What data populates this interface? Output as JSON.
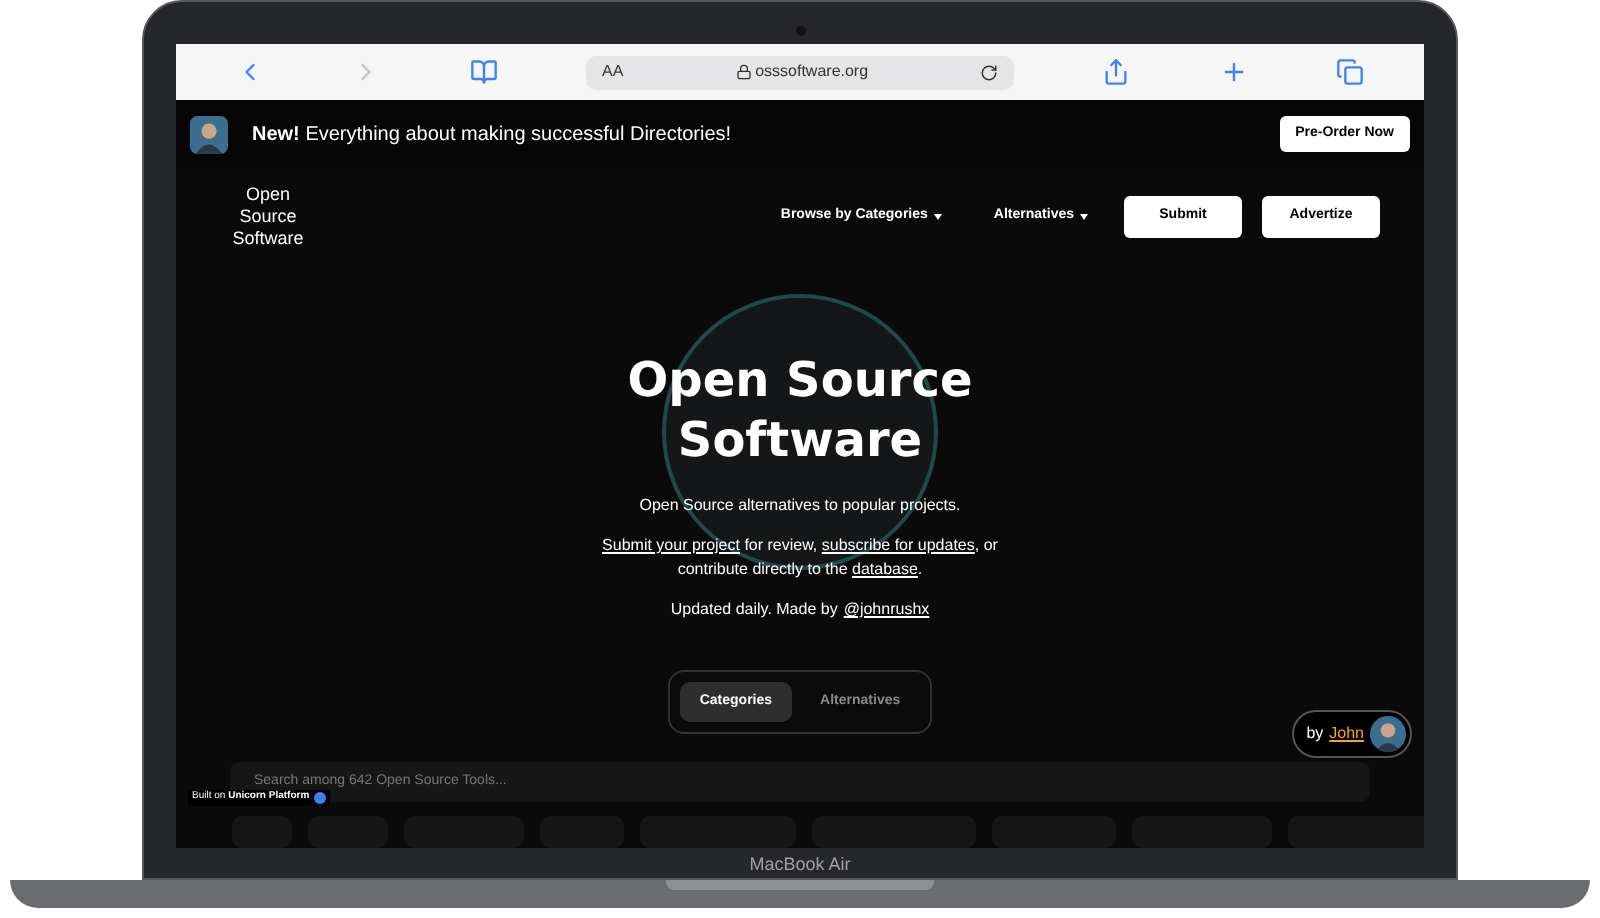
{
  "browser": {
    "text_size": "AA",
    "url": "osssoftware.org"
  },
  "banner": {
    "highlight": "New!",
    "text": "Everything about making successful Directories!",
    "button": "Pre-Order Now"
  },
  "nav": {
    "logo_lines": [
      "Open",
      "Source",
      "Software"
    ],
    "menus": [
      "Browse by Categories",
      "Alternatives"
    ],
    "buttons": [
      "Submit",
      "Advertize"
    ]
  },
  "hero": {
    "title_lines": [
      "Open Source",
      "Software"
    ],
    "subtitle": "Open Source alternatives to popular projects.",
    "paragraph": [
      {
        "text": "Submit your project",
        "kind": "link"
      },
      {
        "text": " for review, ",
        "kind": "text"
      },
      {
        "text": "subscribe for updates",
        "kind": "link"
      },
      {
        "text": ", or contribute directly to the ",
        "kind": "text"
      },
      {
        "text": "database",
        "kind": "link"
      },
      {
        "text": ".",
        "kind": "text"
      }
    ],
    "credit": {
      "text": "Updated daily. Made by",
      "handle": "@johnrushx"
    }
  },
  "tabs": [
    {
      "label": "Categories",
      "selected": true
    },
    {
      "label": "Alternatives",
      "selected": false
    }
  ],
  "search": {
    "placeholder": "Search among 642 Open Source Tools..."
  },
  "platform_badge": {
    "prefix": "Built on",
    "name": "Unicorn Platform"
  },
  "author_badge": {
    "prefix": "by",
    "name": "John"
  },
  "device_label": "MacBook Air"
}
